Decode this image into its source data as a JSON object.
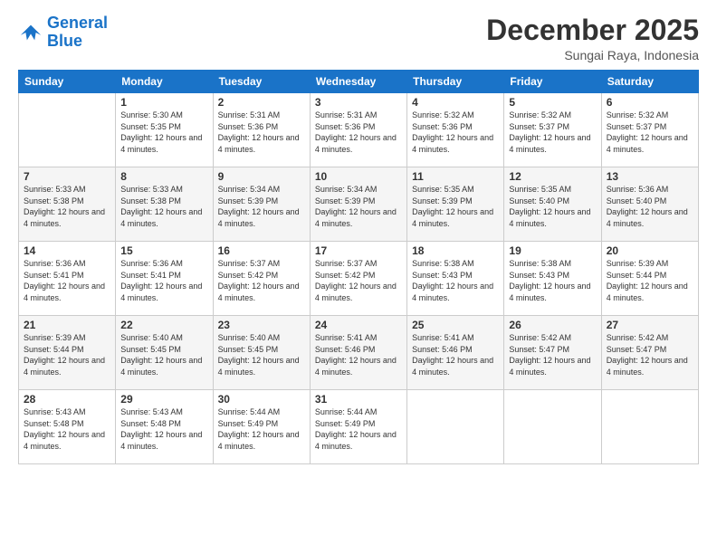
{
  "logo": {
    "line1": "General",
    "line2": "Blue"
  },
  "header": {
    "month": "December 2025",
    "location": "Sungai Raya, Indonesia"
  },
  "weekdays": [
    "Sunday",
    "Monday",
    "Tuesday",
    "Wednesday",
    "Thursday",
    "Friday",
    "Saturday"
  ],
  "weeks": [
    [
      {
        "day": "",
        "sunrise": "",
        "sunset": "",
        "daylight": ""
      },
      {
        "day": "1",
        "sunrise": "Sunrise: 5:30 AM",
        "sunset": "Sunset: 5:35 PM",
        "daylight": "Daylight: 12 hours and 4 minutes."
      },
      {
        "day": "2",
        "sunrise": "Sunrise: 5:31 AM",
        "sunset": "Sunset: 5:36 PM",
        "daylight": "Daylight: 12 hours and 4 minutes."
      },
      {
        "day": "3",
        "sunrise": "Sunrise: 5:31 AM",
        "sunset": "Sunset: 5:36 PM",
        "daylight": "Daylight: 12 hours and 4 minutes."
      },
      {
        "day": "4",
        "sunrise": "Sunrise: 5:32 AM",
        "sunset": "Sunset: 5:36 PM",
        "daylight": "Daylight: 12 hours and 4 minutes."
      },
      {
        "day": "5",
        "sunrise": "Sunrise: 5:32 AM",
        "sunset": "Sunset: 5:37 PM",
        "daylight": "Daylight: 12 hours and 4 minutes."
      },
      {
        "day": "6",
        "sunrise": "Sunrise: 5:32 AM",
        "sunset": "Sunset: 5:37 PM",
        "daylight": "Daylight: 12 hours and 4 minutes."
      }
    ],
    [
      {
        "day": "7",
        "sunrise": "Sunrise: 5:33 AM",
        "sunset": "Sunset: 5:38 PM",
        "daylight": "Daylight: 12 hours and 4 minutes."
      },
      {
        "day": "8",
        "sunrise": "Sunrise: 5:33 AM",
        "sunset": "Sunset: 5:38 PM",
        "daylight": "Daylight: 12 hours and 4 minutes."
      },
      {
        "day": "9",
        "sunrise": "Sunrise: 5:34 AM",
        "sunset": "Sunset: 5:39 PM",
        "daylight": "Daylight: 12 hours and 4 minutes."
      },
      {
        "day": "10",
        "sunrise": "Sunrise: 5:34 AM",
        "sunset": "Sunset: 5:39 PM",
        "daylight": "Daylight: 12 hours and 4 minutes."
      },
      {
        "day": "11",
        "sunrise": "Sunrise: 5:35 AM",
        "sunset": "Sunset: 5:39 PM",
        "daylight": "Daylight: 12 hours and 4 minutes."
      },
      {
        "day": "12",
        "sunrise": "Sunrise: 5:35 AM",
        "sunset": "Sunset: 5:40 PM",
        "daylight": "Daylight: 12 hours and 4 minutes."
      },
      {
        "day": "13",
        "sunrise": "Sunrise: 5:36 AM",
        "sunset": "Sunset: 5:40 PM",
        "daylight": "Daylight: 12 hours and 4 minutes."
      }
    ],
    [
      {
        "day": "14",
        "sunrise": "Sunrise: 5:36 AM",
        "sunset": "Sunset: 5:41 PM",
        "daylight": "Daylight: 12 hours and 4 minutes."
      },
      {
        "day": "15",
        "sunrise": "Sunrise: 5:36 AM",
        "sunset": "Sunset: 5:41 PM",
        "daylight": "Daylight: 12 hours and 4 minutes."
      },
      {
        "day": "16",
        "sunrise": "Sunrise: 5:37 AM",
        "sunset": "Sunset: 5:42 PM",
        "daylight": "Daylight: 12 hours and 4 minutes."
      },
      {
        "day": "17",
        "sunrise": "Sunrise: 5:37 AM",
        "sunset": "Sunset: 5:42 PM",
        "daylight": "Daylight: 12 hours and 4 minutes."
      },
      {
        "day": "18",
        "sunrise": "Sunrise: 5:38 AM",
        "sunset": "Sunset: 5:43 PM",
        "daylight": "Daylight: 12 hours and 4 minutes."
      },
      {
        "day": "19",
        "sunrise": "Sunrise: 5:38 AM",
        "sunset": "Sunset: 5:43 PM",
        "daylight": "Daylight: 12 hours and 4 minutes."
      },
      {
        "day": "20",
        "sunrise": "Sunrise: 5:39 AM",
        "sunset": "Sunset: 5:44 PM",
        "daylight": "Daylight: 12 hours and 4 minutes."
      }
    ],
    [
      {
        "day": "21",
        "sunrise": "Sunrise: 5:39 AM",
        "sunset": "Sunset: 5:44 PM",
        "daylight": "Daylight: 12 hours and 4 minutes."
      },
      {
        "day": "22",
        "sunrise": "Sunrise: 5:40 AM",
        "sunset": "Sunset: 5:45 PM",
        "daylight": "Daylight: 12 hours and 4 minutes."
      },
      {
        "day": "23",
        "sunrise": "Sunrise: 5:40 AM",
        "sunset": "Sunset: 5:45 PM",
        "daylight": "Daylight: 12 hours and 4 minutes."
      },
      {
        "day": "24",
        "sunrise": "Sunrise: 5:41 AM",
        "sunset": "Sunset: 5:46 PM",
        "daylight": "Daylight: 12 hours and 4 minutes."
      },
      {
        "day": "25",
        "sunrise": "Sunrise: 5:41 AM",
        "sunset": "Sunset: 5:46 PM",
        "daylight": "Daylight: 12 hours and 4 minutes."
      },
      {
        "day": "26",
        "sunrise": "Sunrise: 5:42 AM",
        "sunset": "Sunset: 5:47 PM",
        "daylight": "Daylight: 12 hours and 4 minutes."
      },
      {
        "day": "27",
        "sunrise": "Sunrise: 5:42 AM",
        "sunset": "Sunset: 5:47 PM",
        "daylight": "Daylight: 12 hours and 4 minutes."
      }
    ],
    [
      {
        "day": "28",
        "sunrise": "Sunrise: 5:43 AM",
        "sunset": "Sunset: 5:48 PM",
        "daylight": "Daylight: 12 hours and 4 minutes."
      },
      {
        "day": "29",
        "sunrise": "Sunrise: 5:43 AM",
        "sunset": "Sunset: 5:48 PM",
        "daylight": "Daylight: 12 hours and 4 minutes."
      },
      {
        "day": "30",
        "sunrise": "Sunrise: 5:44 AM",
        "sunset": "Sunset: 5:49 PM",
        "daylight": "Daylight: 12 hours and 4 minutes."
      },
      {
        "day": "31",
        "sunrise": "Sunrise: 5:44 AM",
        "sunset": "Sunset: 5:49 PM",
        "daylight": "Daylight: 12 hours and 4 minutes."
      },
      {
        "day": "",
        "sunrise": "",
        "sunset": "",
        "daylight": ""
      },
      {
        "day": "",
        "sunrise": "",
        "sunset": "",
        "daylight": ""
      },
      {
        "day": "",
        "sunrise": "",
        "sunset": "",
        "daylight": ""
      }
    ]
  ]
}
